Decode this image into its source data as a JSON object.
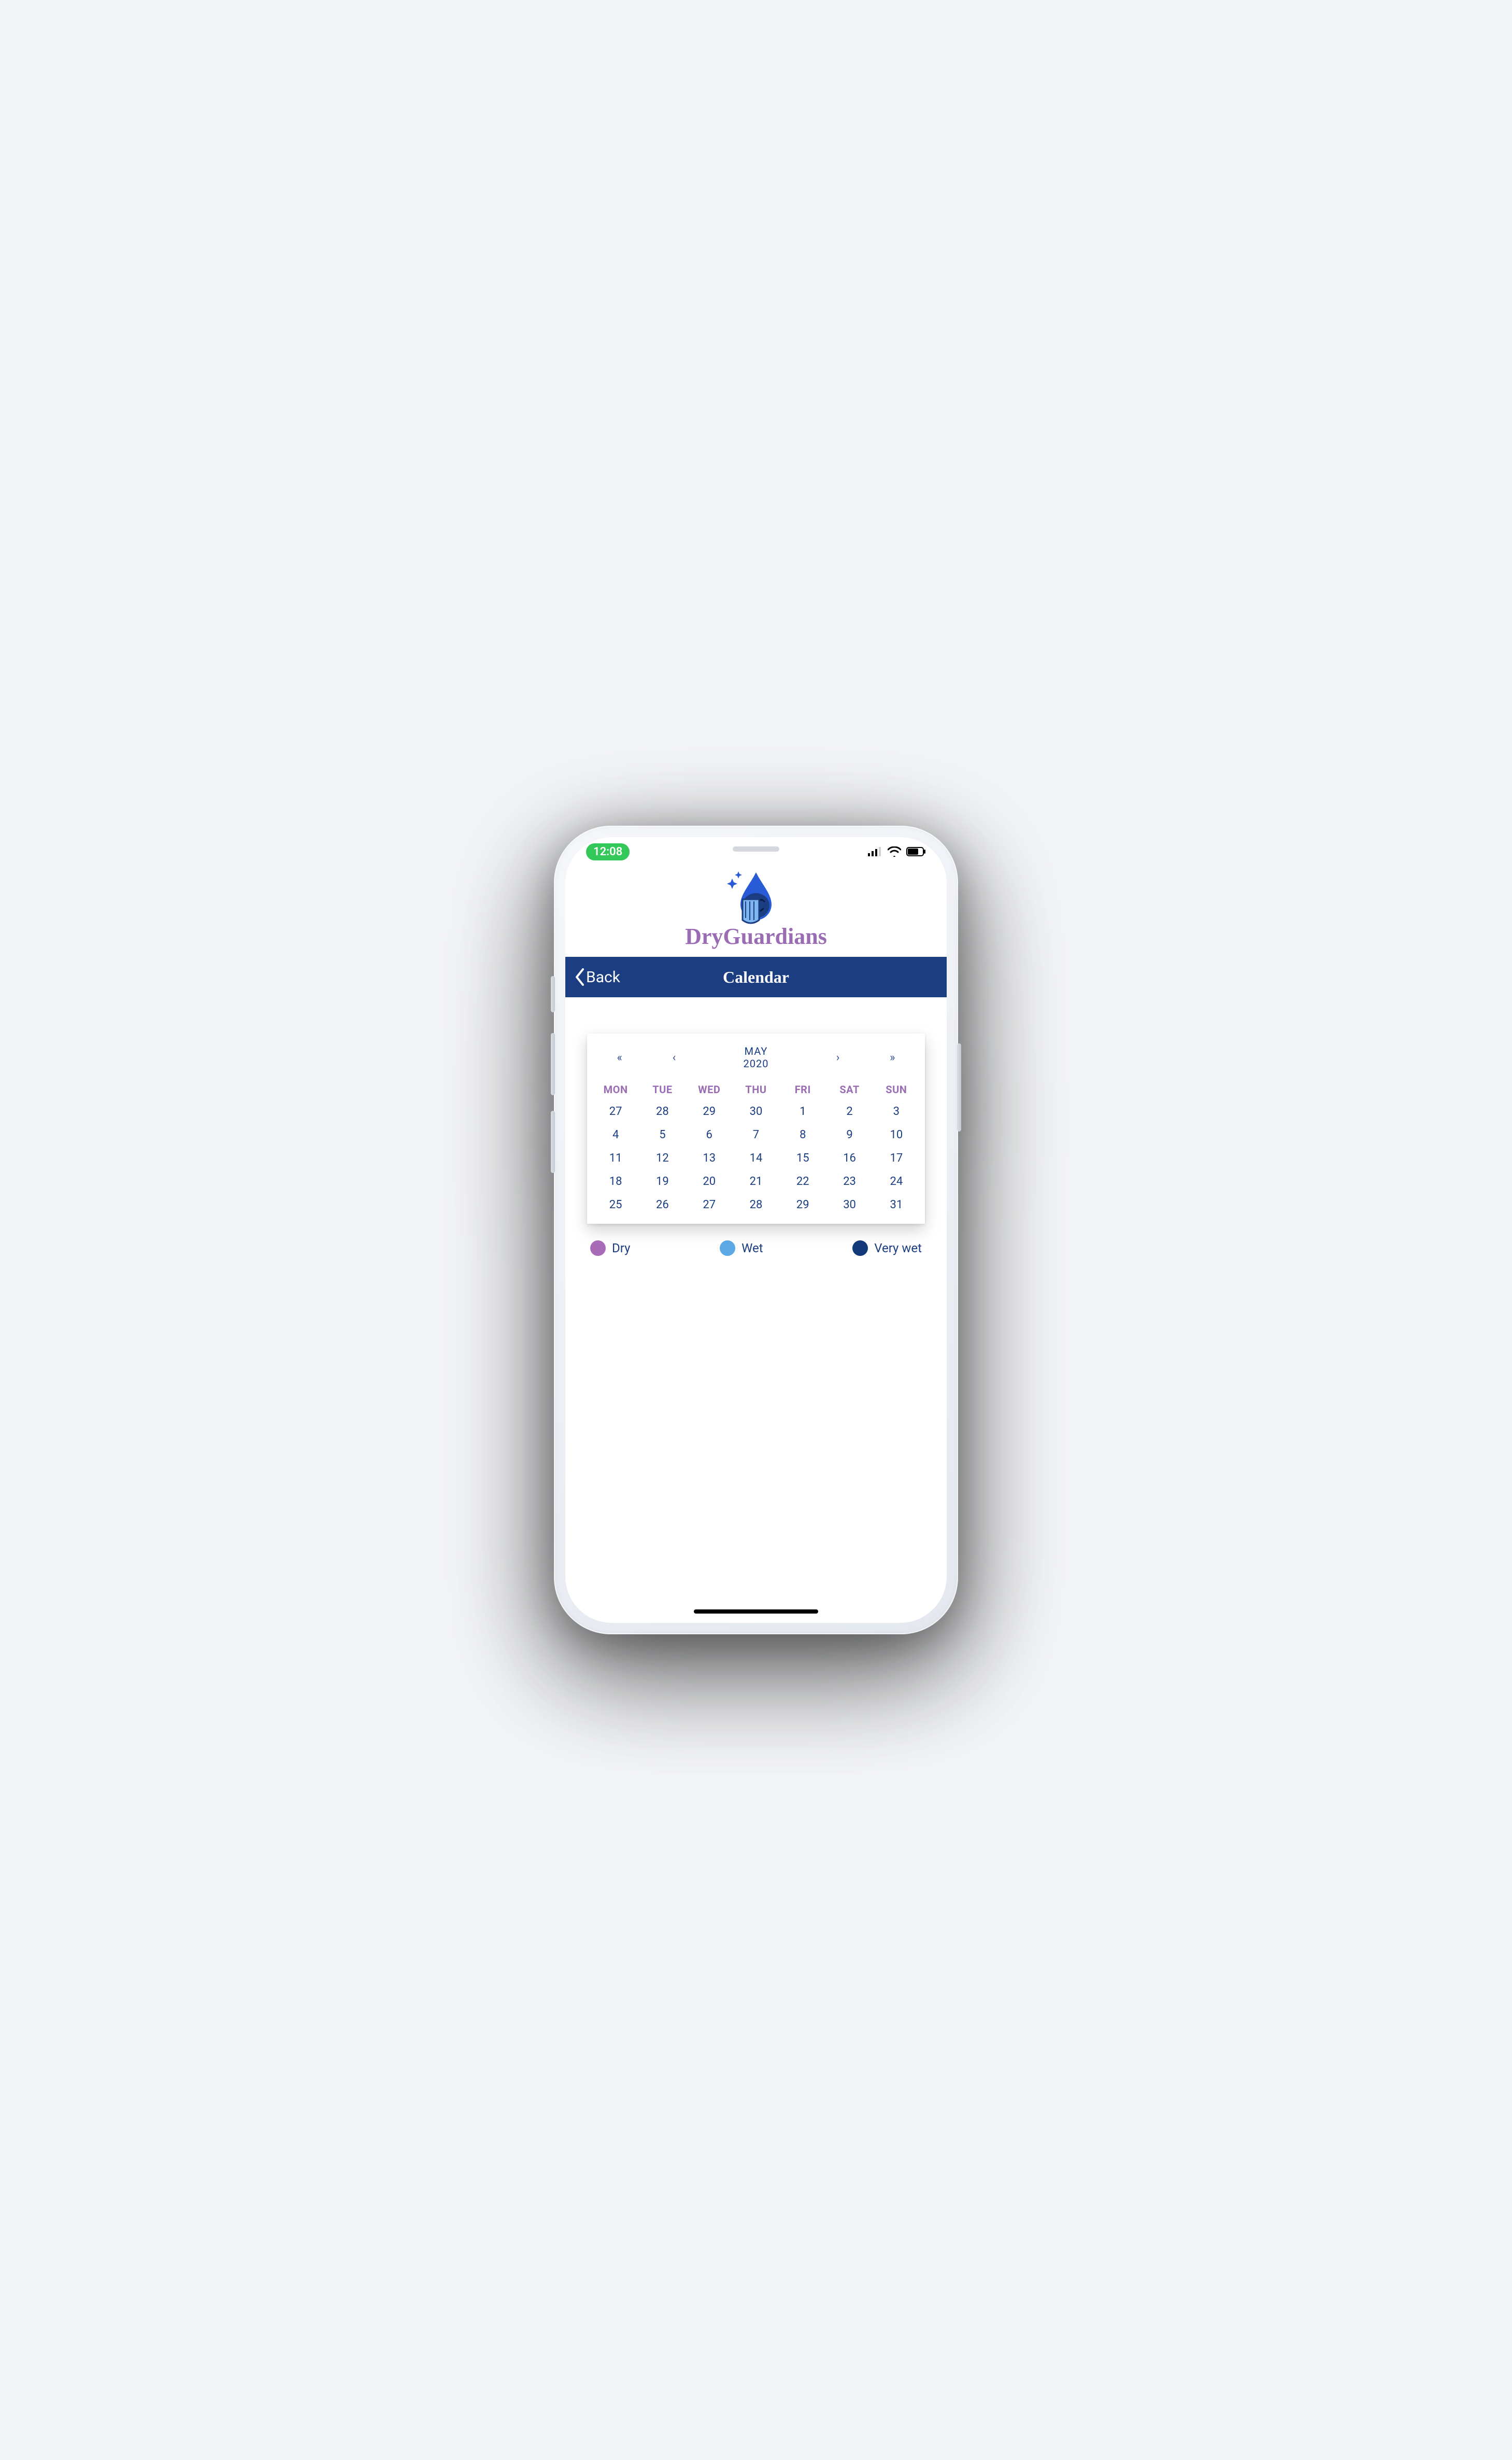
{
  "status": {
    "time": "12:08"
  },
  "brand": {
    "name": "DryGuardians"
  },
  "nav": {
    "back": "Back",
    "title": "Calendar"
  },
  "calendar": {
    "nav": {
      "prevYear": "«",
      "prevMonth": "‹",
      "nextMonth": "›",
      "nextYear": "»"
    },
    "month": "MAY",
    "year": "2020",
    "dayHeaders": [
      "MON",
      "TUE",
      "WED",
      "THU",
      "FRI",
      "SAT",
      "SUN"
    ],
    "weeks": [
      [
        "27",
        "28",
        "29",
        "30",
        "1",
        "2",
        "3"
      ],
      [
        "4",
        "5",
        "6",
        "7",
        "8",
        "9",
        "10"
      ],
      [
        "11",
        "12",
        "13",
        "14",
        "15",
        "16",
        "17"
      ],
      [
        "18",
        "19",
        "20",
        "21",
        "22",
        "23",
        "24"
      ],
      [
        "25",
        "26",
        "27",
        "28",
        "29",
        "30",
        "31"
      ]
    ]
  },
  "legend": {
    "dry": "Dry",
    "wet": "Wet",
    "veryWet": "Very wet"
  },
  "colors": {
    "navy": "#1b3d82",
    "purple": "#9a6cb3",
    "dryDot": "#a86bb7",
    "wetDot": "#5aa8e6",
    "veryWetDot": "#123a7a",
    "timePill": "#34c759"
  }
}
